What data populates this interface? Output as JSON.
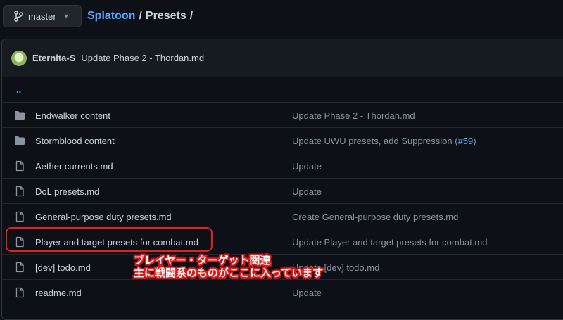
{
  "branch": {
    "label": "master"
  },
  "breadcrumb": {
    "repo": "Splatoon",
    "sep1": "/",
    "folder": "Presets",
    "sep2": "/"
  },
  "commit": {
    "author": "Eternita-S",
    "message": "Update Phase 2 - Thordan.md"
  },
  "parent_link": "..",
  "files": [
    {
      "type": "folder",
      "name": "Endwalker content",
      "message": "Update Phase 2 - Thordan.md"
    },
    {
      "type": "folder",
      "name": "Stormblood content",
      "message": "Update UWU presets, add Suppression (",
      "pr": "#59",
      "message_end": ")"
    },
    {
      "type": "file",
      "name": "Aether currents.md",
      "message": "Update"
    },
    {
      "type": "file",
      "name": "DoL presets.md",
      "message": "Update"
    },
    {
      "type": "file",
      "name": "General-purpose duty presets.md",
      "message": "Create General-purpose duty presets.md"
    },
    {
      "type": "file",
      "name": "Player and target presets for combat.md",
      "message": "Update Player and target presets for combat.md"
    },
    {
      "type": "file",
      "name": "[dev] todo.md",
      "message": "Update [dev] todo.md"
    },
    {
      "type": "file",
      "name": "readme.md",
      "message": "Update"
    }
  ],
  "annotation": {
    "line1": "プレイヤー・ターゲット関連",
    "line2": "主に戦闘系のものがここに入っています"
  },
  "colors": {
    "background": "#0d1117",
    "link": "#58a6ff",
    "muted": "#8b949e",
    "highlight": "#e02020"
  },
  "icons": {
    "branch": "git-branch-icon",
    "folder": "folder-icon",
    "file": "file-icon"
  }
}
